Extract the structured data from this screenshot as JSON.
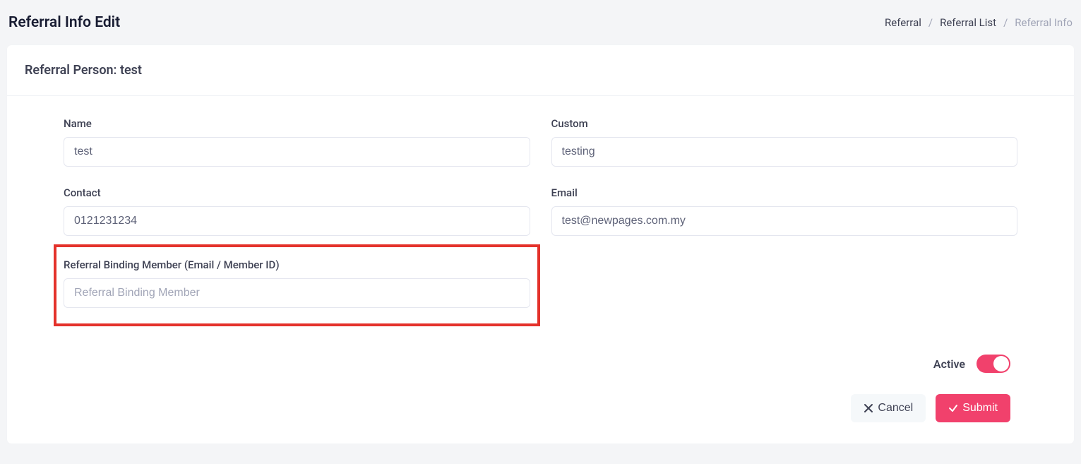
{
  "header": {
    "title": "Referral Info Edit"
  },
  "breadcrumb": {
    "items": [
      {
        "label": "Referral",
        "active": false
      },
      {
        "label": "Referral List",
        "active": false
      },
      {
        "label": "Referral Info",
        "active": true
      }
    ],
    "separator": "/"
  },
  "card": {
    "title_prefix": "Referral Person: ",
    "title_value": "test"
  },
  "form": {
    "name": {
      "label": "Name",
      "value": "test"
    },
    "custom": {
      "label": "Custom",
      "value": "testing"
    },
    "contact": {
      "label": "Contact",
      "value": "0121231234"
    },
    "email": {
      "label": "Email",
      "value": "test@newpages.com.my"
    },
    "binding": {
      "label": "Referral Binding Member (Email / Member ID)",
      "placeholder": "Referral Binding Member",
      "value": ""
    },
    "active": {
      "label": "Active",
      "on": true
    }
  },
  "actions": {
    "cancel": "Cancel",
    "submit": "Submit"
  }
}
